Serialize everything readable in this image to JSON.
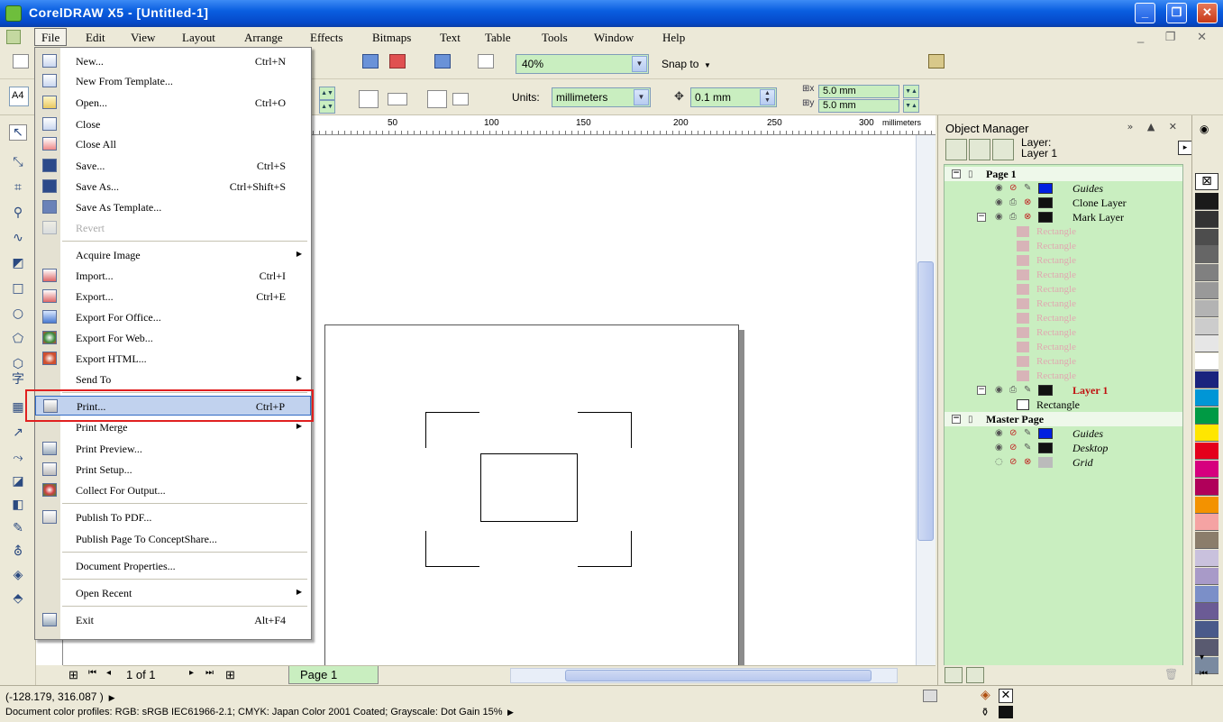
{
  "window": {
    "title": "CorelDRAW X5 - [Untitled-1]",
    "controls": {
      "minimize": "_",
      "maximize": "❐",
      "close": "✕"
    }
  },
  "menubar": {
    "items": [
      "File",
      "Edit",
      "View",
      "Layout",
      "Arrange",
      "Effects",
      "Bitmaps",
      "Text",
      "Table",
      "Tools",
      "Window",
      "Help"
    ],
    "mdi_controls": "_ ❐ ✕"
  },
  "standard_toolbar": {
    "zoom_level": "40%",
    "snap_to_label": "Snap to"
  },
  "property_bar": {
    "paper_size": "A4",
    "units_label": "Units:",
    "units_value": "millimeters",
    "nudge_distance": "0.1 mm",
    "duplicate_x": "5.0 mm",
    "duplicate_y": "5.0 mm"
  },
  "ruler": {
    "ticks": [
      "50",
      "100",
      "150",
      "200",
      "250",
      "300"
    ],
    "units": "millimeters",
    "vertical_units": "millimeters"
  },
  "page_navigator": {
    "page_count": "1 of 1",
    "page_tab": "Page 1"
  },
  "status_bar": {
    "coordinates": "(-128.179, 316.087 )",
    "color_profiles": "Document color profiles: RGB: sRGB IEC61966-2.1; CMYK: Japan Color 2001 Coated; Grayscale: Dot Gain 15%"
  },
  "object_manager": {
    "title": "Object Manager",
    "current_layer_label": "Layer:",
    "current_layer_value": "Layer 1",
    "tree": {
      "page1": "Page 1",
      "guides": "Guides",
      "clone_layer": "Clone Layer",
      "mark_layer": "Mark Layer",
      "rect_children": [
        "Rectangle",
        "Rectangle",
        "Rectangle",
        "Rectangle",
        "Rectangle",
        "Rectangle",
        "Rectangle",
        "Rectangle",
        "Rectangle",
        "Rectangle",
        "Rectangle"
      ],
      "layer1": "Layer 1",
      "layer1_child": "Rectangle",
      "master_page": "Master Page",
      "master_guides": "Guides",
      "master_desktop": "Desktop",
      "master_grid": "Grid"
    }
  },
  "palette_colors": [
    "#1a1a1a",
    "#333333",
    "#4d4d4d",
    "#666666",
    "#808080",
    "#999999",
    "#b3b3b3",
    "#cccccc",
    "#e6e6e6",
    "#ffffff",
    "#1a237e",
    "#0096d6",
    "#009a44",
    "#ffe600",
    "#e4001b",
    "#d6007e",
    "#b0005a",
    "#f39200",
    "#f5a3a3",
    "#8b7d6b",
    "#c9c1dd",
    "#a89ac8",
    "#7b8fc8",
    "#6b5b95",
    "#4a5a8a",
    "#595a70",
    "#7a8aa0"
  ],
  "file_menu": {
    "items": [
      {
        "label": "New...",
        "shortcut": "Ctrl+N"
      },
      {
        "label": "New From Template...",
        "shortcut": ""
      },
      {
        "label": "Open...",
        "shortcut": "Ctrl+O"
      },
      {
        "label": "Close",
        "shortcut": ""
      },
      {
        "label": "Close All",
        "shortcut": ""
      },
      {
        "label": "Save...",
        "shortcut": "Ctrl+S"
      },
      {
        "label": "Save As...",
        "shortcut": "Ctrl+Shift+S"
      },
      {
        "label": "Save As Template...",
        "shortcut": ""
      },
      {
        "label": "Revert",
        "shortcut": ""
      },
      {
        "label": "Acquire Image",
        "shortcut": ""
      },
      {
        "label": "Import...",
        "shortcut": "Ctrl+I"
      },
      {
        "label": "Export...",
        "shortcut": "Ctrl+E"
      },
      {
        "label": "Export For Office...",
        "shortcut": ""
      },
      {
        "label": "Export For Web...",
        "shortcut": ""
      },
      {
        "label": "Export HTML...",
        "shortcut": ""
      },
      {
        "label": "Send To",
        "shortcut": ""
      },
      {
        "label": "Print...",
        "shortcut": "Ctrl+P"
      },
      {
        "label": "Print Merge",
        "shortcut": ""
      },
      {
        "label": "Print Preview...",
        "shortcut": ""
      },
      {
        "label": "Print Setup...",
        "shortcut": ""
      },
      {
        "label": "Collect For Output...",
        "shortcut": ""
      },
      {
        "label": "Publish To PDF...",
        "shortcut": ""
      },
      {
        "label": "Publish Page To ConceptShare...",
        "shortcut": ""
      },
      {
        "label": "Document Properties...",
        "shortcut": ""
      },
      {
        "label": "Open Recent",
        "shortcut": ""
      },
      {
        "label": "Exit",
        "shortcut": "Alt+F4"
      }
    ]
  }
}
